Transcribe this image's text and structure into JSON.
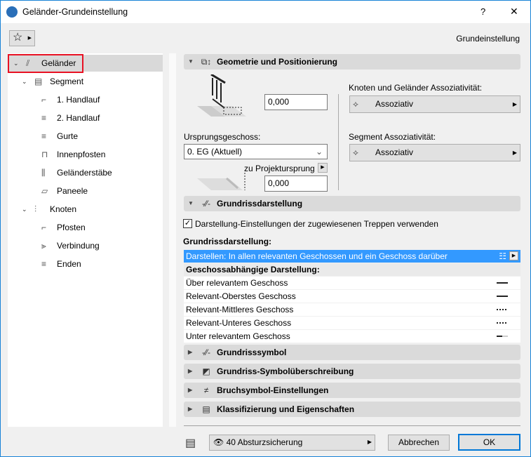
{
  "window": {
    "title": "Geländer-Grundeinstellung",
    "help": "?",
    "close": "✕"
  },
  "header": {
    "right_label": "Grundeinstellung"
  },
  "tree": [
    {
      "label": "Geländer",
      "level": 0,
      "icon": "railing-icon",
      "expanded": true,
      "selected": true
    },
    {
      "label": "Segment",
      "level": 1,
      "icon": "segment-icon",
      "expanded": true
    },
    {
      "label": "1. Handlauf",
      "level": 2,
      "icon": "handrail-icon"
    },
    {
      "label": "2. Handlauf",
      "level": 2,
      "icon": "handrail2-icon"
    },
    {
      "label": "Gurte",
      "level": 2,
      "icon": "rails-icon"
    },
    {
      "label": "Innenpfosten",
      "level": 2,
      "icon": "inner-post-icon"
    },
    {
      "label": "Geländerstäbe",
      "level": 2,
      "icon": "balusters-icon"
    },
    {
      "label": "Paneele",
      "level": 2,
      "icon": "panel-icon"
    },
    {
      "label": "Knoten",
      "level": 1,
      "icon": "node-icon",
      "expanded": true
    },
    {
      "label": "Pfosten",
      "level": 2,
      "icon": "post-icon"
    },
    {
      "label": "Verbindung",
      "level": 2,
      "icon": "connection-icon"
    },
    {
      "label": "Enden",
      "level": 2,
      "icon": "ends-icon"
    }
  ],
  "geometry": {
    "title": "Geometrie und Positionierung",
    "height_value": "0,000",
    "origin_label": "Ursprungsgeschoss:",
    "origin_value": "0. EG (Aktuell)",
    "to_origin_label": "zu Projektursprung",
    "offset_value": "0,000",
    "node_assoc_label": "Knoten und Geländer Assoziativität:",
    "node_assoc_value": "Assoziativ",
    "segment_assoc_label": "Segment Assoziativität:",
    "segment_assoc_value": "Assoziativ"
  },
  "floorplan": {
    "title": "Grundrissdarstellung",
    "checkbox_label": "Darstellung-Einstellungen der zugewiesenen Treppen verwenden",
    "checkbox_checked": true,
    "list_label": "Grundrissdarstellung:",
    "selected_row": "Darstellen: In allen relevanten Geschossen und ein Geschoss darüber",
    "group_header": "Geschossabhängige Darstellung:",
    "rows": [
      "Über relevantem Geschoss",
      "Relevant-Oberstes Geschoss",
      "Relevant-Mittleres Geschoss",
      "Relevant-Unteres Geschoss",
      "Unter relevantem Geschoss"
    ]
  },
  "collapsed_sections": [
    "Grundrisssymbol",
    "Grundriss-Symbolüberschreibung",
    "Bruchsymbol-Einstellungen",
    "Klassifizierung und Eigenschaften"
  ],
  "footer": {
    "layer": "40 Absturzsicherung",
    "cancel": "Abbrechen",
    "ok": "OK"
  },
  "colors": {
    "accent": "#0078d7",
    "selection": "#3399ff",
    "highlight_box": "#e81123"
  }
}
